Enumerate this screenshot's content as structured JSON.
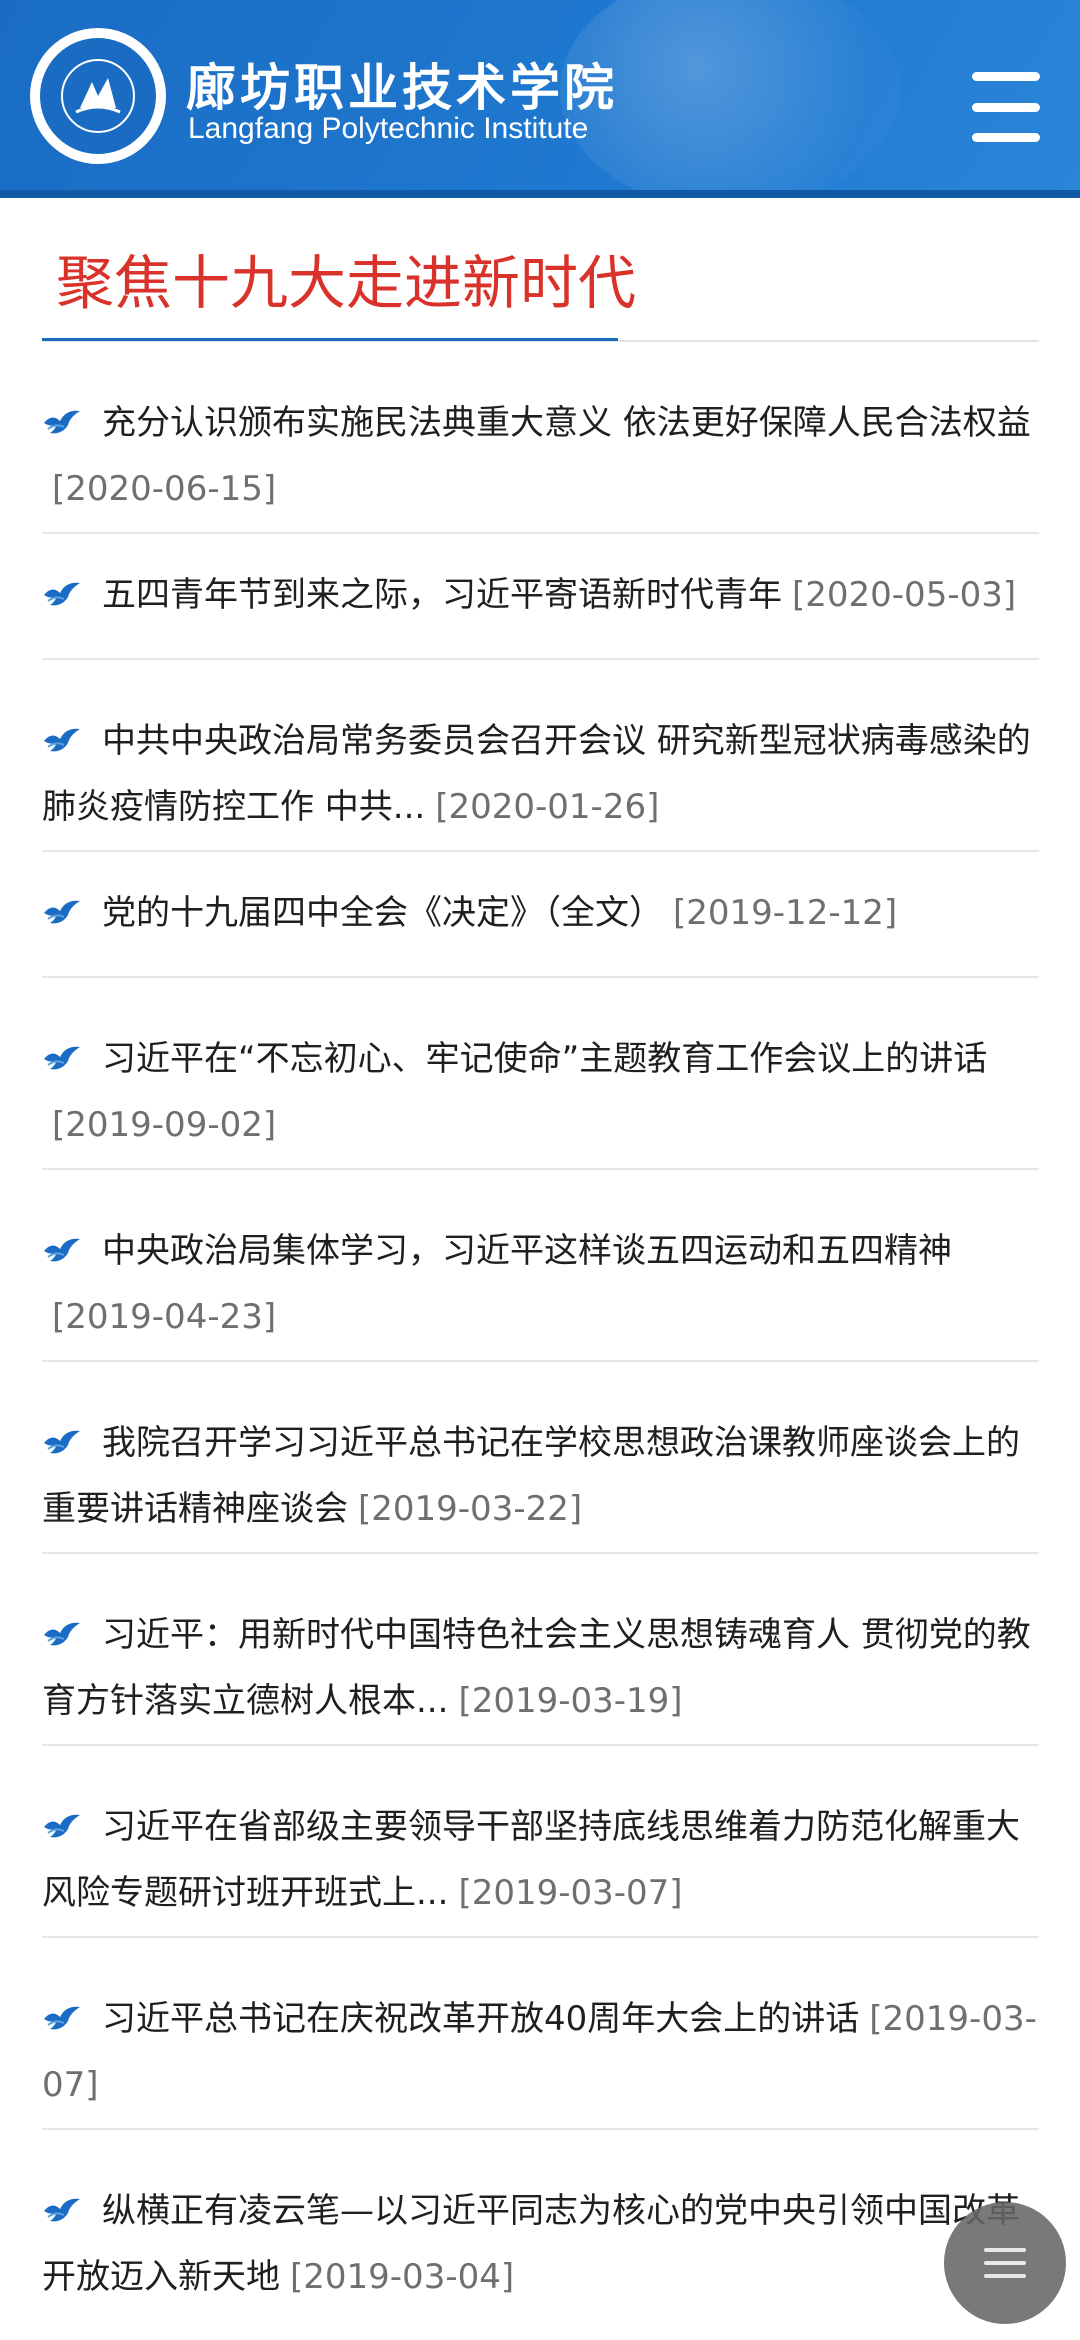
{
  "header": {
    "logo_cn": "廊坊职业技术学院",
    "logo_en": "Langfang Polytechnic Institute",
    "menu_icon": "hamburger-menu-icon"
  },
  "section": {
    "title": "聚焦十九大走进新时代"
  },
  "news": [
    {
      "title": "充分认识颁布实施民法典重大意义 依法更好保障人民合法权益",
      "date": "[2020-06-15]"
    },
    {
      "title": "五四青年节到来之际，习近平寄语新时代青年",
      "date": "[2020-05-03]"
    },
    {
      "title": "中共中央政治局常务委员会召开会议 研究新型冠状病毒感染的肺炎疫情防控工作 中共...",
      "date": "[2020-01-26]"
    },
    {
      "title": "党的十九届四中全会《决定》（全文）",
      "date": "[2019-12-12]"
    },
    {
      "title": "习近平在“不忘初心、牢记使命”主题教育工作会议上的讲话",
      "date": "[2019-09-02]"
    },
    {
      "title": "中央政治局集体学习，习近平这样谈五四运动和五四精神",
      "date": "[2019-04-23]"
    },
    {
      "title": "我院召开学习习近平总书记在学校思想政治课教师座谈会上的重要讲话精神座谈会",
      "date": "[2019-03-22]"
    },
    {
      "title": "习近平：用新时代中国特色社会主义思想铸魂育人 贯彻党的教育方针落实立德树人根本...",
      "date": "[2019-03-19]"
    },
    {
      "title": "习近平在省部级主要领导干部坚持底线思维着力防范化解重大风险专题研讨班开班式上...",
      "date": "[2019-03-07]"
    },
    {
      "title": "习近平总书记在庆祝改革开放40周年大会上的讲话",
      "date": "[2019-03-07]"
    },
    {
      "title": "纵横正有凌云笔—以习近平同志为核心的党中央引领中国改革开放迈入新天地",
      "date": "[2019-03-04]"
    }
  ],
  "icons": {
    "bullet": "bird-icon",
    "float": "floating-menu-icon"
  },
  "colors": {
    "header_blue": "#1a6cc3",
    "title_red": "#d9322a",
    "accent_blue": "#1a6cc3",
    "date_gray": "#6f6f6f"
  }
}
